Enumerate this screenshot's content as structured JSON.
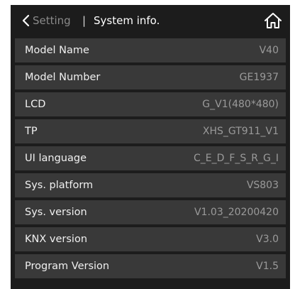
{
  "header": {
    "back_label": "Setting",
    "separator": "|",
    "title": "System info."
  },
  "icons": {
    "back": "chevron-left-icon",
    "home": "home-icon"
  },
  "colors": {
    "screen_background": "#1c1c1c",
    "row_background": "#393939",
    "label_text": "#f0f0f0",
    "value_text": "#9a9a9a",
    "parent_crumb_text": "#8a8a8a"
  },
  "rows": [
    {
      "label": "Model Name",
      "value": "V40"
    },
    {
      "label": "Model Number",
      "value": "GE1937"
    },
    {
      "label": "LCD",
      "value": "G_V1(480*480)"
    },
    {
      "label": "TP",
      "value": "XHS_GT911_V1"
    },
    {
      "label": "UI language",
      "value": "C_E_D_F_S_R_G_I"
    },
    {
      "label": "Sys. platform",
      "value": "VS803"
    },
    {
      "label": "Sys. version",
      "value": "V1.03_20200420"
    },
    {
      "label": "KNX version",
      "value": "V3.0"
    },
    {
      "label": "Program Version",
      "value": "V1.5"
    }
  ]
}
